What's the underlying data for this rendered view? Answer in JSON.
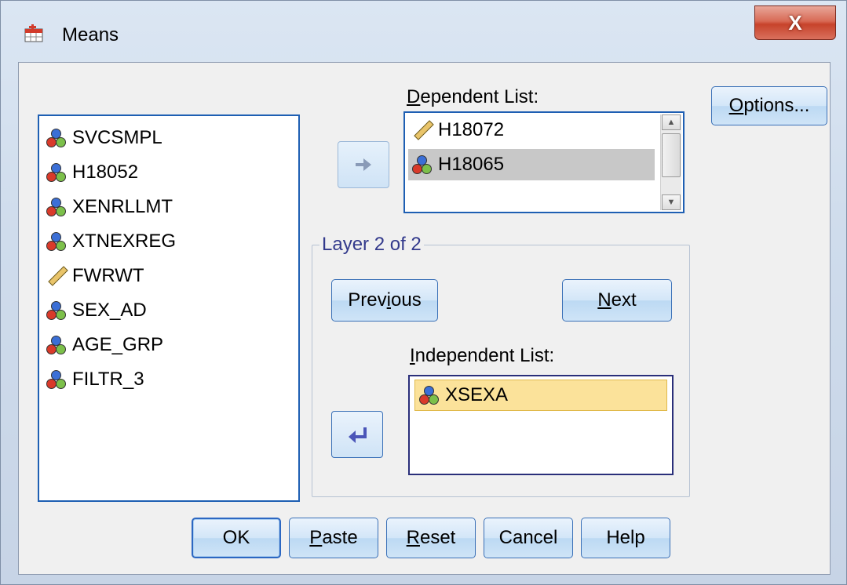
{
  "window": {
    "title": "Means",
    "close_label": "X"
  },
  "source_list": {
    "items": [
      {
        "label": "SVCSMPL",
        "icon": "nominal-variable-icon"
      },
      {
        "label": "H18052",
        "icon": "nominal-variable-icon"
      },
      {
        "label": "XENRLLMT",
        "icon": "nominal-variable-icon"
      },
      {
        "label": "XTNEXREG",
        "icon": "nominal-variable-icon"
      },
      {
        "label": "FWRWT",
        "icon": "scale-variable-icon"
      },
      {
        "label": "SEX_AD",
        "icon": "nominal-variable-icon"
      },
      {
        "label": "AGE_GRP",
        "icon": "nominal-variable-icon"
      },
      {
        "label": "FILTR_3",
        "icon": "nominal-variable-icon"
      }
    ]
  },
  "dependent": {
    "label": "Dependent List:",
    "items": [
      {
        "label": "H18072",
        "icon": "scale-variable-icon"
      },
      {
        "label": "H18065",
        "icon": "nominal-variable-icon",
        "selected": true
      }
    ]
  },
  "layer": {
    "title": "Layer 2 of 2",
    "previous_label": "Previous",
    "next_label": "Next"
  },
  "independent": {
    "label": "Independent List:",
    "items": [
      {
        "label": "XSEXA",
        "icon": "nominal-variable-icon",
        "selected": true
      }
    ]
  },
  "buttons": {
    "options": "Options...",
    "ok": "OK",
    "paste": "Paste",
    "reset": "Reset",
    "cancel": "Cancel",
    "help": "Help"
  },
  "colors": {
    "selection_gray": "#c8c8c8",
    "selection_yellow": "#fbe29a",
    "list_border": "#1e5fb3",
    "group_title": "#333a8c"
  }
}
